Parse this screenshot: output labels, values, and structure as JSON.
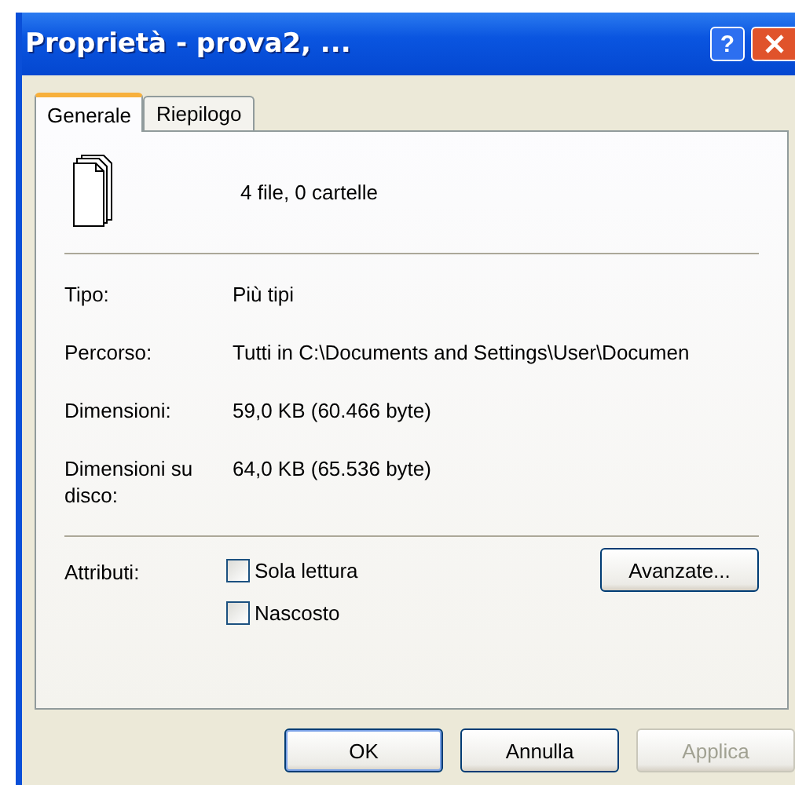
{
  "window": {
    "title": "Proprietà - prova2, ...",
    "help": "?"
  },
  "tabs": [
    {
      "label": "Generale",
      "selected": true
    },
    {
      "label": "Riepilogo",
      "selected": false
    }
  ],
  "summary": "4 file, 0 cartelle",
  "properties": [
    {
      "label": "Tipo:",
      "value": "Più tipi"
    },
    {
      "label": "Percorso:",
      "value": "Tutti in C:\\Documents and Settings\\User\\Documen"
    },
    {
      "label": "Dimensioni:",
      "value": "59,0 KB (60.466 byte)"
    },
    {
      "label": "Dimensioni su disco:",
      "value": "64,0 KB (65.536 byte)"
    }
  ],
  "attributes": {
    "label": "Attributi:",
    "options": [
      {
        "label": "Sola lettura",
        "checked": false
      },
      {
        "label": "Nascosto",
        "checked": false
      }
    ],
    "advanced": "Avanzate..."
  },
  "buttons": [
    {
      "label": "OK",
      "disabled": false,
      "default": true
    },
    {
      "label": "Annulla",
      "disabled": false,
      "default": false
    },
    {
      "label": "Applica",
      "disabled": true,
      "default": false
    }
  ]
}
